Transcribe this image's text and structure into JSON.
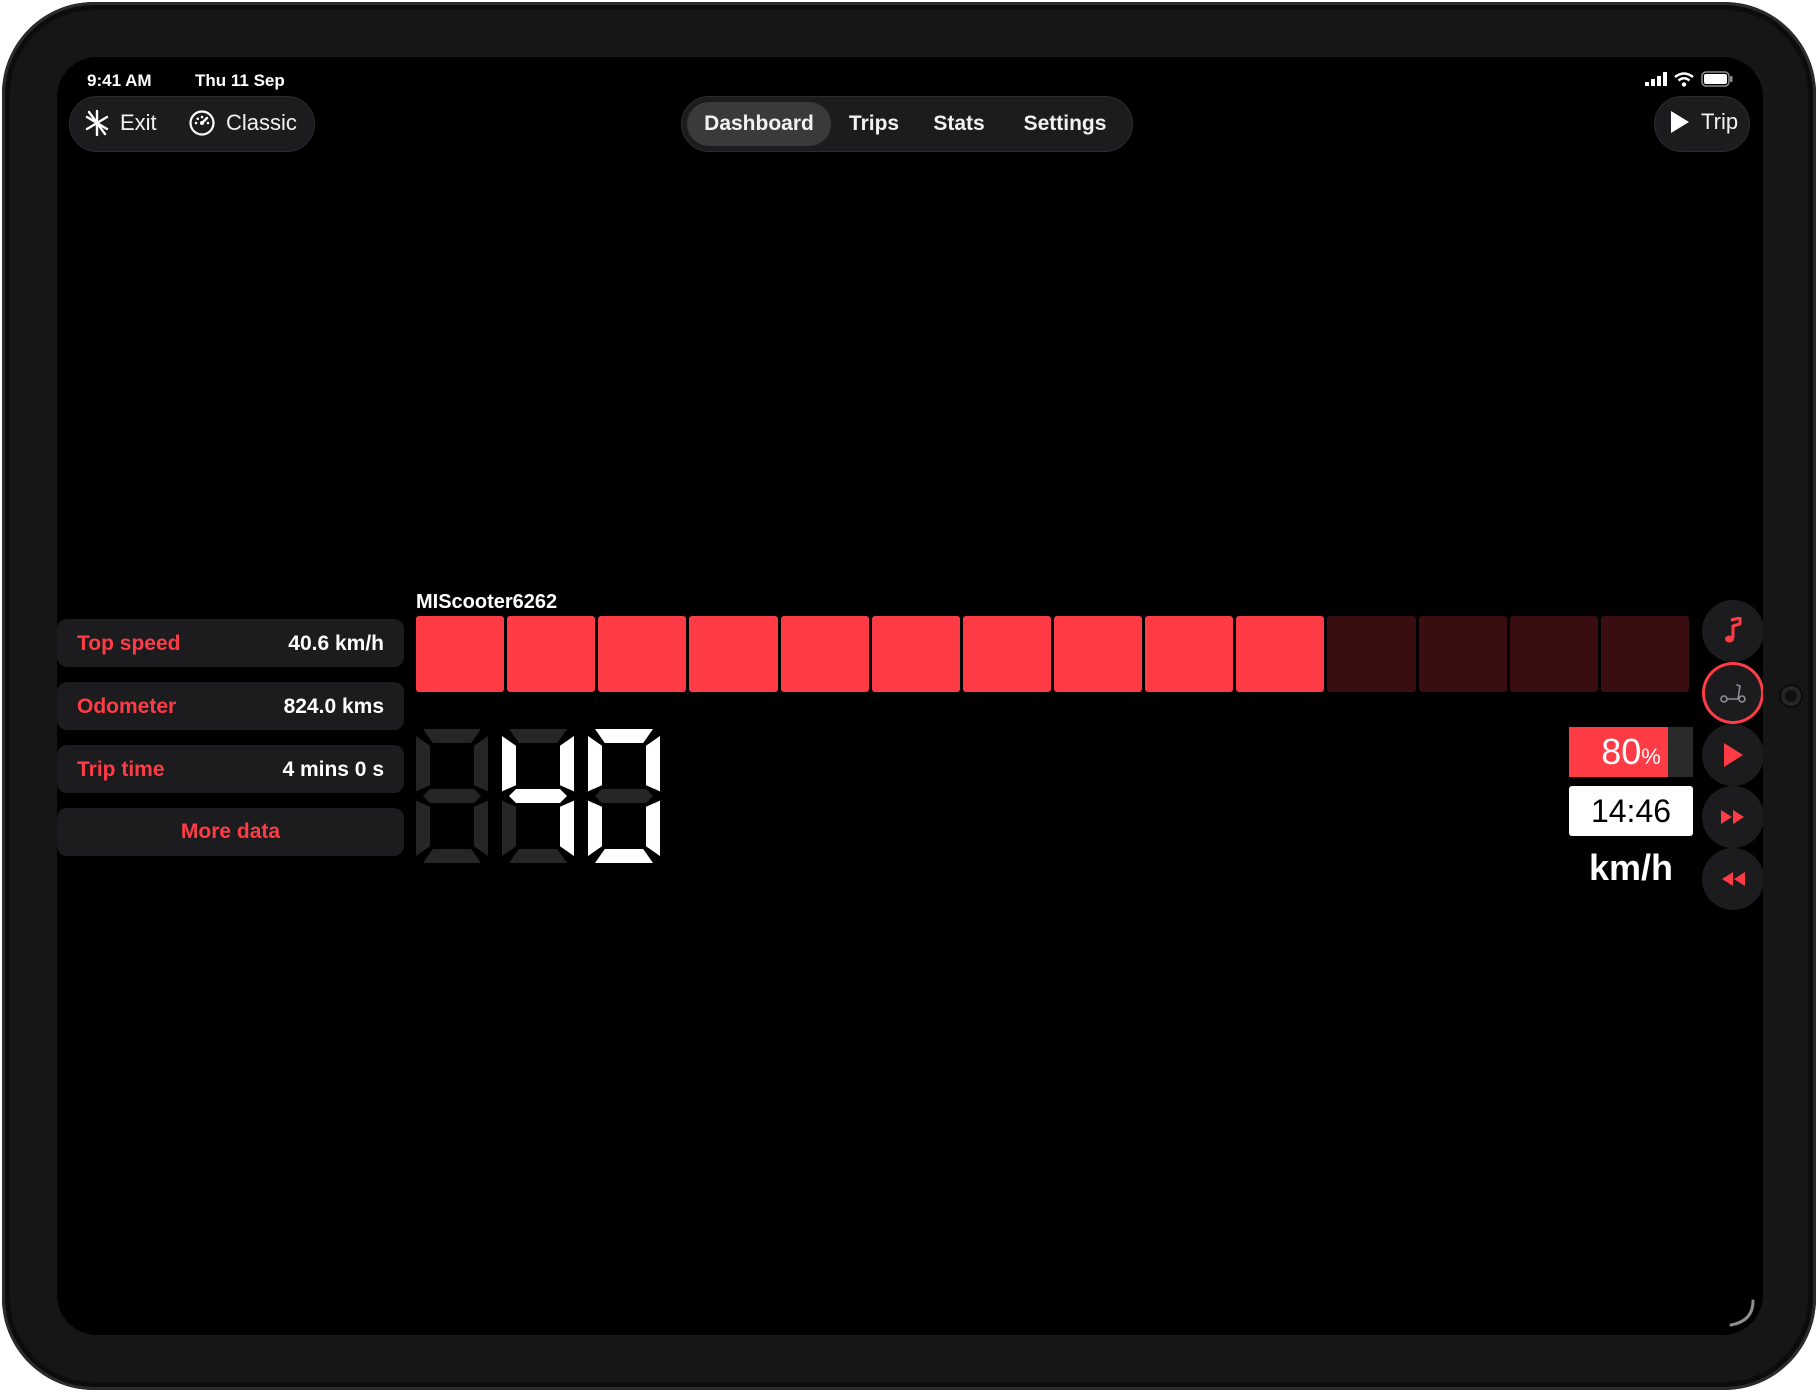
{
  "status": {
    "time": "9:41 AM",
    "date": "Thu 11 Sep"
  },
  "toolbar": {
    "exit_label": "Exit",
    "classic_label": "Classic",
    "trip_label": "Trip"
  },
  "tabs": [
    {
      "label": "Dashboard",
      "active": true
    },
    {
      "label": "Trips",
      "active": false
    },
    {
      "label": "Stats",
      "active": false
    },
    {
      "label": "Settings",
      "active": false
    }
  ],
  "stats": [
    {
      "label": "Top speed",
      "value": "40.6 km/h"
    },
    {
      "label": "Odometer",
      "value": "824.0 kms"
    },
    {
      "label": "Trip time",
      "value": "4 mins 0 s"
    }
  ],
  "more_data_label": "More data",
  "device_name": "MIScooter6262",
  "speed_bar": {
    "segments_total": 14,
    "segments_lit": 10
  },
  "speed": {
    "digits": "040",
    "unit": "km/h"
  },
  "battery": {
    "value": "80",
    "unit": "%",
    "level": 0.8
  },
  "ride_time": "14:46",
  "colors": {
    "accent": "#ff3b46",
    "bar_off": "#3a0d10",
    "dim_digit": "#262626",
    "panel": "#1c1c1e"
  },
  "side_controls": [
    "music-icon",
    "scooter-icon",
    "play-icon",
    "fast-forward-icon",
    "rewind-icon"
  ]
}
